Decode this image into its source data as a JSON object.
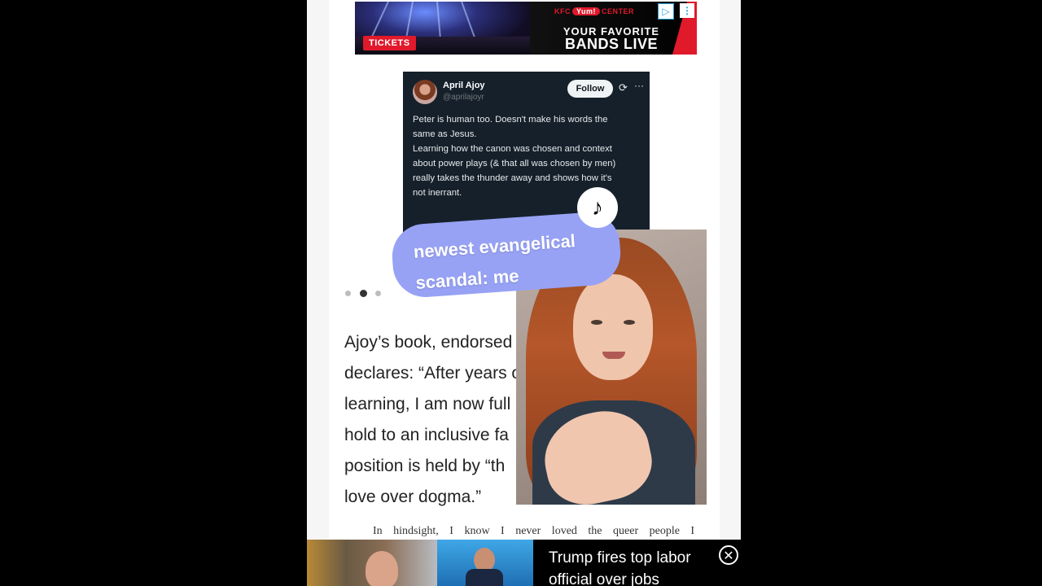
{
  "ad": {
    "venue": "KFC Yum! CENTER",
    "venue_prefix": "KFC",
    "venue_pill": "Yum!",
    "venue_suffix": "CENTER",
    "line1": "YOUR FAVORITE",
    "line2": "BANDS LIVE",
    "tickets": "TICKETS",
    "adchoices_icon": "play-triangle-icon",
    "menu_icon": "vertical-dots-icon"
  },
  "tweet": {
    "name": "April Ajoy",
    "handle": "@aprilajoyr",
    "follow_label": "Follow",
    "refresh_icon": "refresh-icon",
    "more_icon": "more-horizontal-icon",
    "body_lines": [
      "Peter is human too. Doesn't make his words the",
      "same as Jesus.",
      "Learning how the canon was chosen and context",
      "about power plays (& that all was chosen by men)",
      "really takes the thunder away and shows how it's",
      "not inerrant."
    ]
  },
  "carousel": {
    "count": 3,
    "active": 2
  },
  "article": {
    "lines": [
      "Ajoy’s book, endorsed by",
      "declares: “After years of",
      "learning, I am now full",
      "hold to an inclusive fa",
      "position is held by “th",
      "love over dogma.”"
    ],
    "quote": "In hindsight, I know I never loved the queer people I"
  },
  "overlay": {
    "caption_line1": "newest evangelical",
    "caption_line2": "scandal: me",
    "tiktok_icon": "tiktok-logo-icon"
  },
  "bottom_ad": {
    "headline_line1": "Trump fires top labor",
    "headline_line2": "official over jobs",
    "close_icon": "close-circle-icon"
  }
}
